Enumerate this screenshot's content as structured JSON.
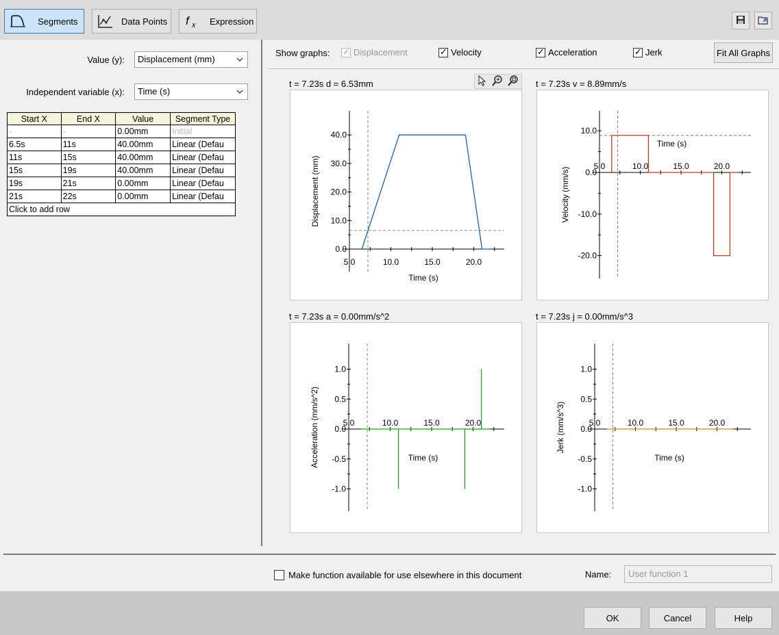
{
  "toolbar": {
    "modes": [
      {
        "label": "Segments",
        "icon": "segments-curve-icon",
        "active": true
      },
      {
        "label": "Data Points",
        "icon": "data-points-chart-icon",
        "active": false
      },
      {
        "label": "Expression",
        "icon": "fx-function-icon",
        "active": false
      }
    ],
    "right_icons": [
      "save-icon",
      "open-folder-icon"
    ]
  },
  "left": {
    "value_label": "Value (y):",
    "value_selected": "Displacement (mm)",
    "indep_label": "Independent variable (x):",
    "indep_selected": "Time (s)",
    "table": {
      "headers": [
        "Start X",
        "End X",
        "Value",
        "Segment Type"
      ],
      "rows": [
        [
          "-",
          "-",
          "0.00mm",
          "Initial"
        ],
        [
          "6.5s",
          "11s",
          "40.00mm",
          "Linear (Defau"
        ],
        [
          "11s",
          "15s",
          "40.00mm",
          "Linear (Defau"
        ],
        [
          "15s",
          "19s",
          "40.00mm",
          "Linear (Defau"
        ],
        [
          "19s",
          "21s",
          "0.00mm",
          "Linear (Defau"
        ],
        [
          "21s",
          "22s",
          "0.00mm",
          "Linear (Defau"
        ]
      ],
      "add_row": "Click to add row"
    }
  },
  "graphs_header": {
    "show_label": "Show graphs:",
    "checks": [
      {
        "label": "Displacement",
        "checked": true,
        "disabled": true
      },
      {
        "label": "Velocity",
        "checked": true,
        "disabled": false
      },
      {
        "label": "Acceleration",
        "checked": true,
        "disabled": false
      },
      {
        "label": "Jerk",
        "checked": true,
        "disabled": false
      }
    ],
    "fit_button": "Fit All Graphs"
  },
  "graphs": {
    "disp_title": "t = 7.23s  d = 6.53mm",
    "vel_title": "t = 7.23s  v = 8.89mm/s",
    "acc_title": "t = 7.23s  a = 0.00mm/s^2",
    "jerk_title": "t = 7.23s  j = 0.00mm/s^3"
  },
  "chart_data": [
    {
      "type": "line",
      "ylabel": "Displacement (mm)",
      "xlabel": "Time (s)",
      "color": "#1f5fa6",
      "x": [
        6.5,
        11,
        15,
        19,
        21,
        22
      ],
      "y": [
        0,
        40,
        40,
        40,
        0,
        0
      ],
      "xticks": [
        "5.0",
        "10.0",
        "15.0",
        "20.0"
      ],
      "yticks": [
        "0.0",
        "10.0",
        "20.0",
        "30.0",
        "40.0"
      ],
      "cursor_x": 7.23,
      "cursor_y": 6.53
    },
    {
      "type": "line",
      "ylabel": "Velocity (mm/s)",
      "xlabel": "Time (s)",
      "color": "#c0392b",
      "x": [
        6.5,
        6.5,
        11,
        11,
        19,
        19,
        21,
        21,
        22
      ],
      "y": [
        0,
        8.89,
        8.89,
        0,
        0,
        -20,
        -20,
        0,
        0
      ],
      "xticks": [
        "5.0",
        "10.0",
        "15.0",
        "20.0"
      ],
      "yticks": [
        "-20.0",
        "-10.0",
        "0.0",
        "10.0"
      ],
      "cursor_x": 7.23,
      "cursor_y": 8.89
    },
    {
      "type": "line",
      "ylabel": "Acceleration (mm/s^2)",
      "xlabel": "Time (s)",
      "color": "#2e9a2e",
      "x": [
        6.5,
        11,
        11,
        11,
        19,
        19,
        19,
        21,
        21,
        21,
        22
      ],
      "y": [
        0,
        0,
        -1,
        0,
        0,
        -1,
        0,
        0,
        1,
        0,
        0
      ],
      "xticks": [
        "5.0",
        "10.0",
        "15.0",
        "20.0"
      ],
      "yticks": [
        "-1.0",
        "-0.5",
        "0.0",
        "0.5",
        "1.0"
      ],
      "cursor_x": 7.23,
      "cursor_y": 0
    },
    {
      "type": "line",
      "ylabel": "Jerk (mm/s^3)",
      "xlabel": "Time (s)",
      "color": "#c8823a",
      "x": [
        6.5,
        22
      ],
      "y": [
        0,
        0
      ],
      "xticks": [
        "5.0",
        "10.0",
        "15.0",
        "20.0"
      ],
      "yticks": [
        "-1.0",
        "-0.5",
        "0.0",
        "0.5",
        "1.0"
      ],
      "cursor_x": 7.23,
      "cursor_y": 0
    }
  ],
  "bottom": {
    "make_available_label": "Make function available for use elsewhere in this document",
    "make_available_checked": false,
    "name_label": "Name:",
    "name_placeholder": "User function 1"
  },
  "buttons": {
    "ok": "OK",
    "cancel": "Cancel",
    "help": "Help"
  }
}
